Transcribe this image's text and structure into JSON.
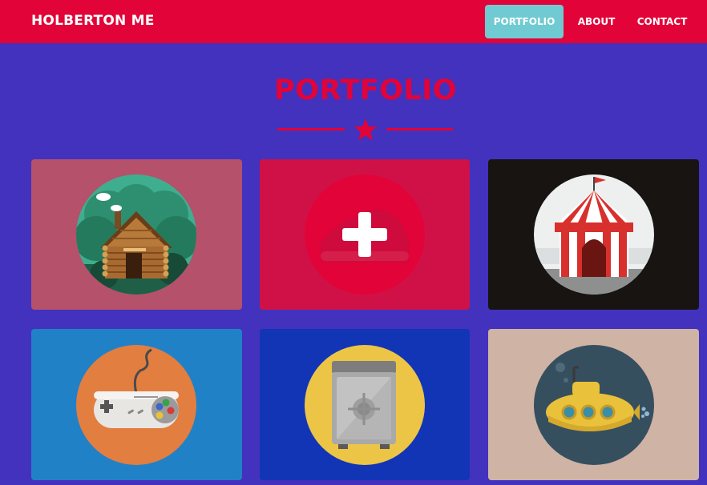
{
  "navbar": {
    "brand": "HOLBERTON ME",
    "items": [
      {
        "label": "PORTFOLIO",
        "active": true
      },
      {
        "label": "ABOUT",
        "active": false
      },
      {
        "label": "CONTACT",
        "active": false
      }
    ]
  },
  "section": {
    "title": "PORTFOLIO",
    "divider_icon": "star-icon"
  },
  "portfolio_items": [
    {
      "icon": "log-cabin-icon",
      "card_color": "#b5516a"
    },
    {
      "icon": "plus-icon",
      "card_color": "#d01147"
    },
    {
      "icon": "circus-tent-icon",
      "card_color": "#171412"
    },
    {
      "icon": "game-controller-icon",
      "card_color": "#2181c7"
    },
    {
      "icon": "safe-icon",
      "card_color": "#1235b6"
    },
    {
      "icon": "submarine-icon",
      "card_color": "#cfb3a5"
    }
  ],
  "colors": {
    "primary": "#e20338",
    "background": "#4232be",
    "active_nav": "#6fcbd1"
  }
}
